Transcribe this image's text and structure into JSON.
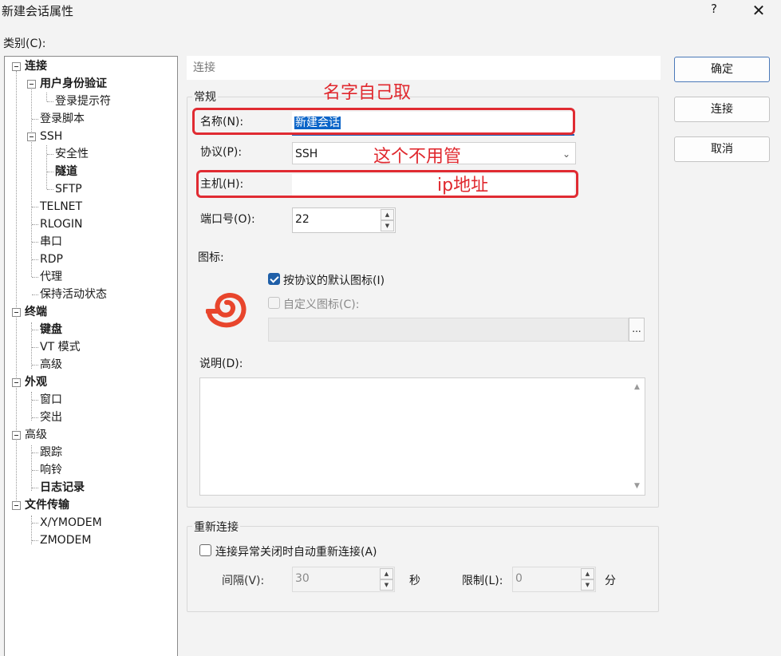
{
  "window": {
    "title": "新建会话属性",
    "help_label": "?",
    "close_label": "✕"
  },
  "category_label": "类别(C):",
  "tree": {
    "items": [
      {
        "label": "连接",
        "bold": true
      },
      {
        "label": "用户身份验证",
        "bold": true
      },
      {
        "label": "登录提示符",
        "bold": false
      },
      {
        "label": "登录脚本",
        "bold": false
      },
      {
        "label": "SSH",
        "bold": false
      },
      {
        "label": "安全性",
        "bold": false
      },
      {
        "label": "隧道",
        "bold": true
      },
      {
        "label": "SFTP",
        "bold": false
      },
      {
        "label": "TELNET",
        "bold": false
      },
      {
        "label": "RLOGIN",
        "bold": false
      },
      {
        "label": "串口",
        "bold": false
      },
      {
        "label": "RDP",
        "bold": false
      },
      {
        "label": "代理",
        "bold": false
      },
      {
        "label": "保持活动状态",
        "bold": false
      },
      {
        "label": "终端",
        "bold": true
      },
      {
        "label": "键盘",
        "bold": true
      },
      {
        "label": "VT 模式",
        "bold": false
      },
      {
        "label": "高级",
        "bold": false
      },
      {
        "label": "外观",
        "bold": true
      },
      {
        "label": "窗口",
        "bold": false
      },
      {
        "label": "突出",
        "bold": false
      },
      {
        "label": "高级",
        "bold": false
      },
      {
        "label": "跟踪",
        "bold": false
      },
      {
        "label": "响铃",
        "bold": false
      },
      {
        "label": "日志记录",
        "bold": true
      },
      {
        "label": "文件传输",
        "bold": true
      },
      {
        "label": "X/YMODEM",
        "bold": false
      },
      {
        "label": "ZMODEM",
        "bold": false
      }
    ]
  },
  "section_header": "连接",
  "buttons": {
    "ok": "确定",
    "connect": "连接",
    "cancel": "取消"
  },
  "general": {
    "group_title": "常规",
    "name_label": "名称(N):",
    "name_value": "新建会话",
    "protocol_label": "协议(P):",
    "protocol_value": "SSH",
    "host_label": "主机(H):",
    "host_value": "",
    "port_label": "端口号(O):",
    "port_value": "22",
    "icon_label": "图标:",
    "default_icon_checkbox": "按协议的默认图标(I)",
    "default_icon_checked": true,
    "custom_icon_checkbox": "自定义图标(C):",
    "custom_icon_checked": false,
    "browse_label": "...",
    "description_label": "说明(D):"
  },
  "reconnect": {
    "group_title": "重新连接",
    "auto_reconnect_checkbox": "连接异常关闭时自动重新连接(A)",
    "auto_reconnect_checked": false,
    "interval_label": "间隔(V):",
    "interval_value": "30",
    "interval_unit": "秒",
    "limit_label": "限制(L):",
    "limit_value": "0",
    "limit_unit": "分"
  },
  "annotations": {
    "name_note": "名字自己取",
    "protocol_note": "这个不用管",
    "host_note": "ip地址"
  },
  "colors": {
    "annotation_red": "#e02b32",
    "checkbox_blue": "#1f5fa8",
    "selection_blue": "#0a64c8",
    "icon_orange": "#e8452c"
  }
}
